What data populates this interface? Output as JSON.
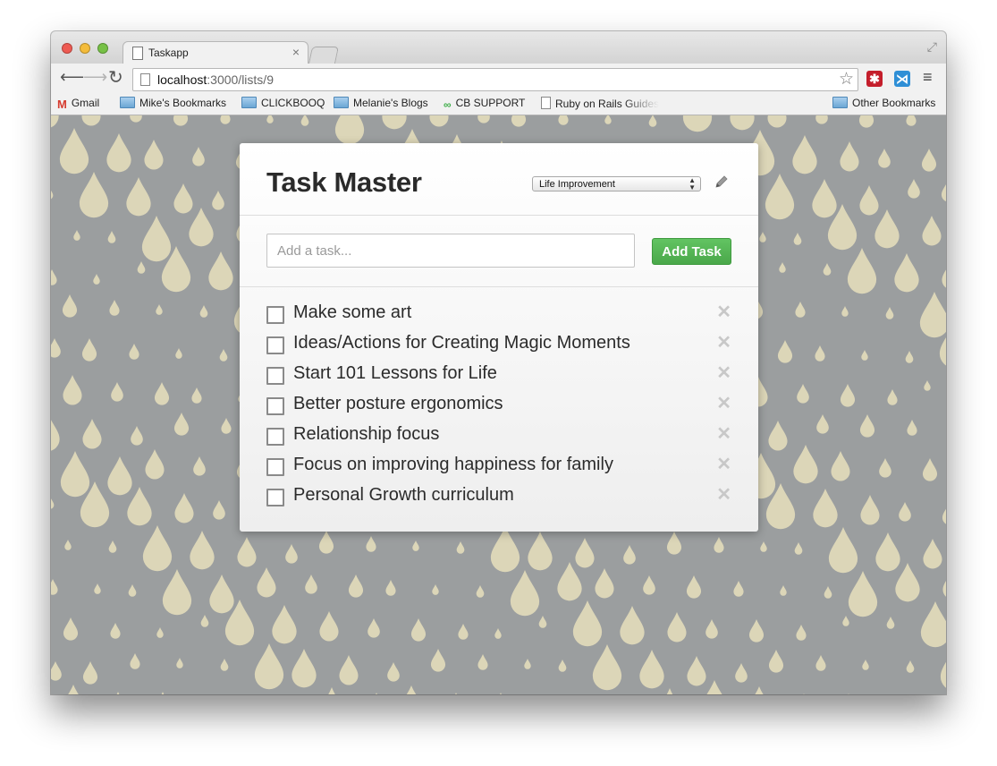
{
  "browser": {
    "tab_title": "Taskapp",
    "url_host": "localhost",
    "url_path": ":3000/lists/9",
    "bookmarks": [
      {
        "label": "Gmail",
        "icon": "gmail-icon"
      },
      {
        "label": "Mike's Bookmarks",
        "icon": "folder-icon"
      },
      {
        "label": "CLICKBOOQ",
        "icon": "folder-icon"
      },
      {
        "label": "Melanie's Blogs",
        "icon": "folder-icon"
      },
      {
        "label": "CB SUPPORT",
        "icon": "link-icon"
      },
      {
        "label": "Ruby on Rails Guides",
        "icon": "page-icon"
      }
    ],
    "other_bookmarks": "Other Bookmarks"
  },
  "app": {
    "title": "Task Master",
    "selected_list": "Life Improvement",
    "input_placeholder": "Add a task...",
    "add_button_label": "Add Task",
    "tasks": [
      {
        "label": "Make some art",
        "done": false
      },
      {
        "label": "Ideas/Actions for Creating Magic Moments",
        "done": false
      },
      {
        "label": "Start 101 Lessons for Life",
        "done": false
      },
      {
        "label": "Better posture ergonomics",
        "done": false
      },
      {
        "label": "Relationship focus",
        "done": false
      },
      {
        "label": "Focus on improving happiness for family",
        "done": false
      },
      {
        "label": "Personal Growth curriculum",
        "done": false
      }
    ]
  },
  "colors": {
    "background": "#9b9e9f",
    "raindrop": "#dcd6b8",
    "accent_green": "#4aa84a"
  }
}
